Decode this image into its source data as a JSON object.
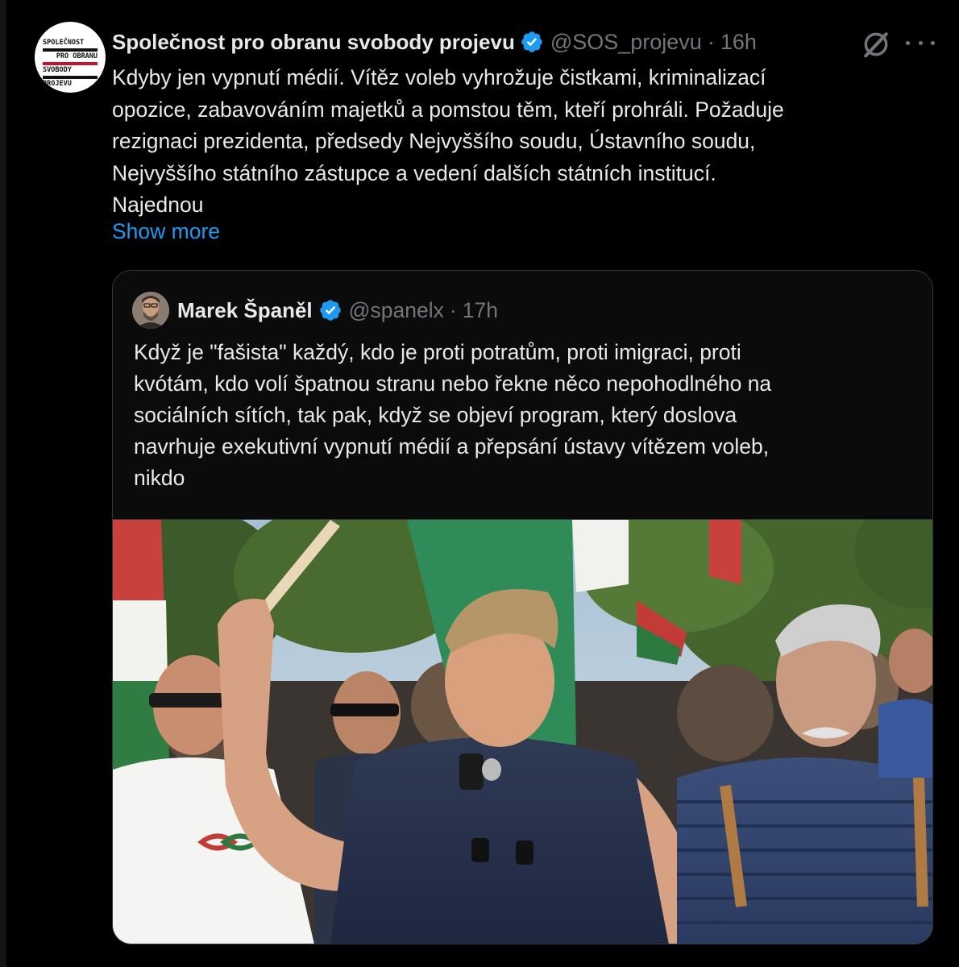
{
  "post": {
    "author_name": "Společnost pro obranu svobody projevu",
    "handle": "@SOS_projevu",
    "separator": "·",
    "time": "16h",
    "avatar_logo_lines": [
      "SPOLEČNOST",
      "PRO OBRANU",
      "SVOBODY",
      "PROJEVU"
    ],
    "text_lines": [
      "Kdyby jen vypnutí médií. Vítěz voleb vyhrožuje čistkami, kriminalizací",
      "opozice, zabavováním majetků a pomstou těm, kteří prohráli. Požaduje",
      "rezignaci prezidenta, předsedy Nejvyššího soudu, Ústavního soudu,",
      "Nejvyššího státního zástupce a vedení dalších státních institucí.",
      "Najednou"
    ],
    "show_more": "Show more"
  },
  "quote": {
    "author_name": "Marek Španěl",
    "handle": "@spanelx",
    "separator": "·",
    "time": "17h",
    "text_lines": [
      "Když je \"fašista\" každý, kdo je proti potratům, proti imigraci, proti",
      "kvótám, kdo volí špatnou stranu nebo řekne něco nepohodlného na",
      "sociálních sítích, tak pak, když se objeví program, který doslova",
      "navrhuje exekutivní vypnutí médií a přepsání ústavy vítězem voleb,",
      "nikdo"
    ]
  },
  "colors": {
    "background": "#000000",
    "text": "#e7e9ea",
    "muted": "#71767b",
    "link": "#1d9bf0",
    "verified": "#1d9bf0",
    "border": "#333639"
  },
  "icons": {
    "verified": "verified-badge-icon",
    "grok": "grok-icon",
    "more": "more-options-icon"
  }
}
